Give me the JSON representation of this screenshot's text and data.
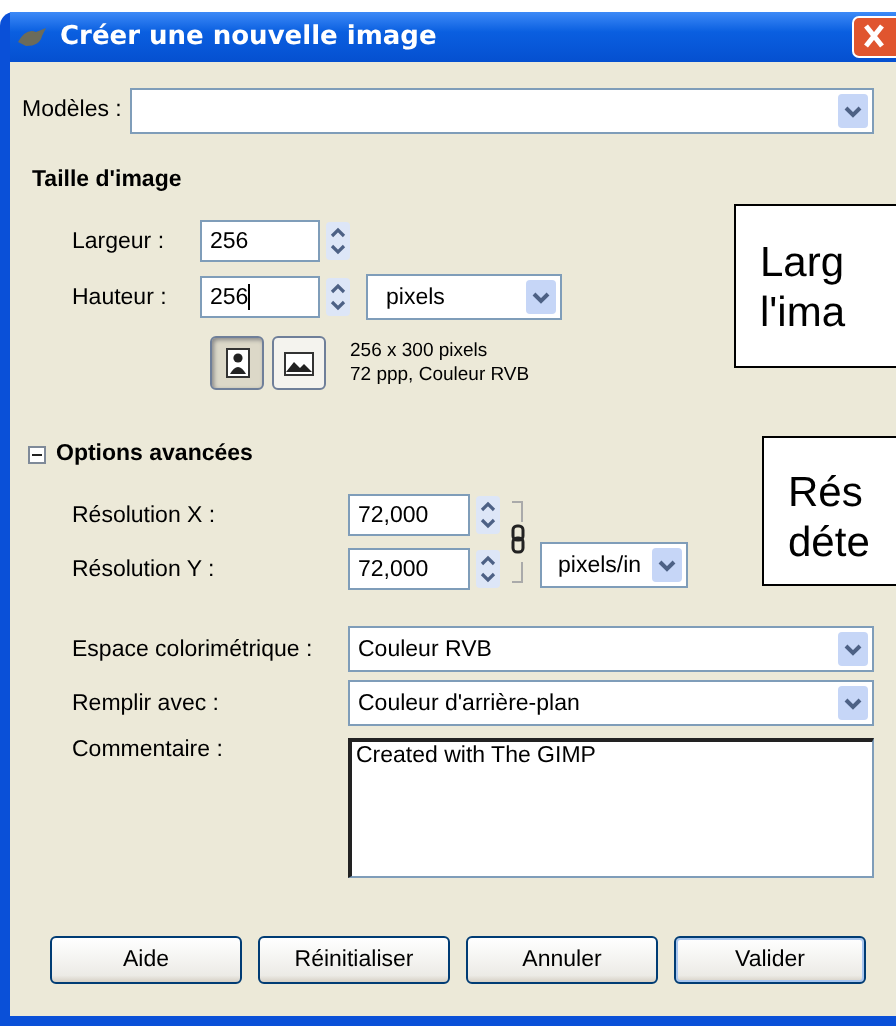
{
  "window": {
    "title": "Créer une nouvelle image"
  },
  "template": {
    "label": "Modèles :"
  },
  "image_size": {
    "heading": "Taille d'image",
    "width": {
      "label": "Largeur :",
      "value": "256",
      "focused": false
    },
    "height": {
      "label": "Hauteur :",
      "value": "256",
      "focused": true
    },
    "unit": "pixels",
    "orientations": [
      {
        "kind": "portrait",
        "selected": true
      },
      {
        "kind": "landscape",
        "selected": false
      }
    ],
    "info": [
      "256 x 300 pixels",
      "72 ppp, Couleur RVB"
    ]
  },
  "advanced": {
    "heading": "Options avancées",
    "expanded": true,
    "x_resolution": {
      "label": "Résolution X :",
      "value": "72,000"
    },
    "y_resolution": {
      "label": "Résolution Y :",
      "value": "72,000"
    },
    "resolution_unit": "pixels/in",
    "color_space": {
      "label": "Espace colorimétrique :",
      "value": "Couleur RVB"
    },
    "fill": {
      "label": "Remplir avec :",
      "value": "Couleur d'arrière-plan"
    },
    "comment": {
      "label": "Commentaire :",
      "value": "Created with The GIMP"
    }
  },
  "buttons": [
    "Aide",
    "Réinitialiser",
    "Annuler",
    "Valider"
  ],
  "callouts": [
    {
      "lines": [
        "Larg",
        "l'ima"
      ]
    },
    {
      "lines": [
        "Rés",
        "déte"
      ]
    }
  ]
}
